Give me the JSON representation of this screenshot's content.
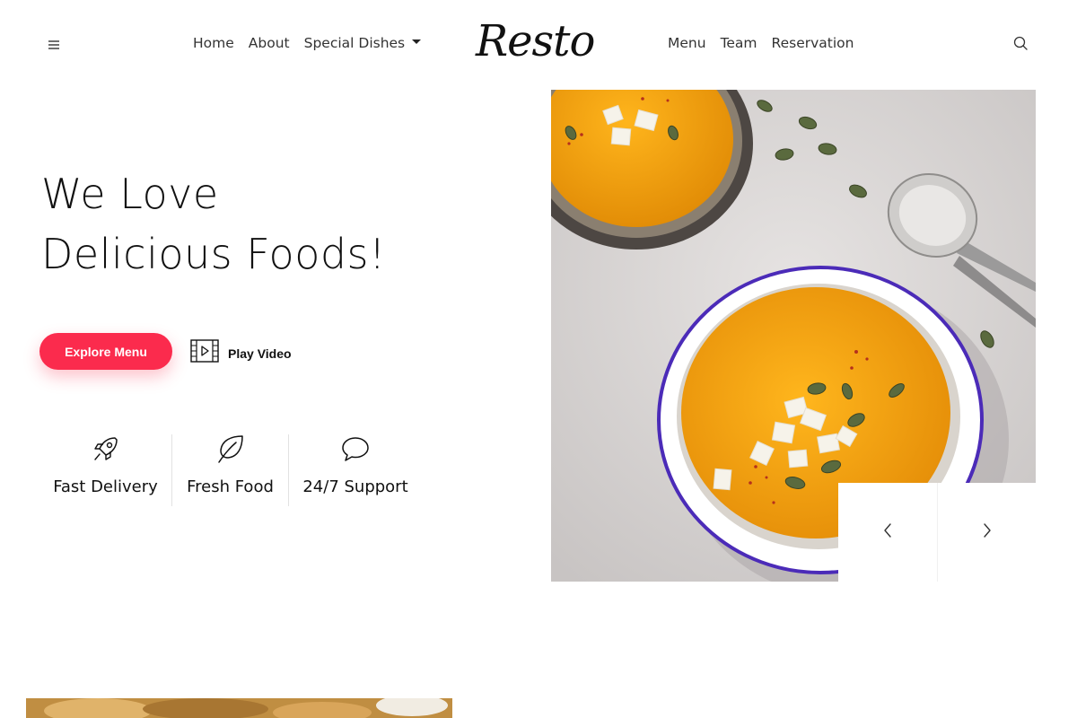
{
  "header": {
    "logo": "Resto",
    "nav_left": [
      "Home",
      "About",
      "Special Dishes"
    ],
    "nav_right": [
      "Menu",
      "Team",
      "Reservation"
    ],
    "icons": {
      "menu": "hamburger-icon",
      "search": "search-icon",
      "dropdown": "caret-down-icon"
    }
  },
  "hero": {
    "title_line1": "We Love",
    "title_line2": "Delicious Foods!",
    "explore_label": "Explore Menu",
    "play_label": "Play Video"
  },
  "features": [
    {
      "icon": "rocket-icon",
      "label": "Fast Delivery"
    },
    {
      "icon": "leaf-icon",
      "label": "Fresh Food"
    },
    {
      "icon": "chat-bubble-icon",
      "label": "24/7 Support"
    }
  ],
  "slider": {
    "prev_icon": "chevron-left-icon",
    "next_icon": "chevron-right-icon"
  },
  "colors": {
    "accent": "#fb2b4d",
    "text": "#111111",
    "soup": "#f5a614",
    "bowl_rim": "#4b2bb8"
  }
}
